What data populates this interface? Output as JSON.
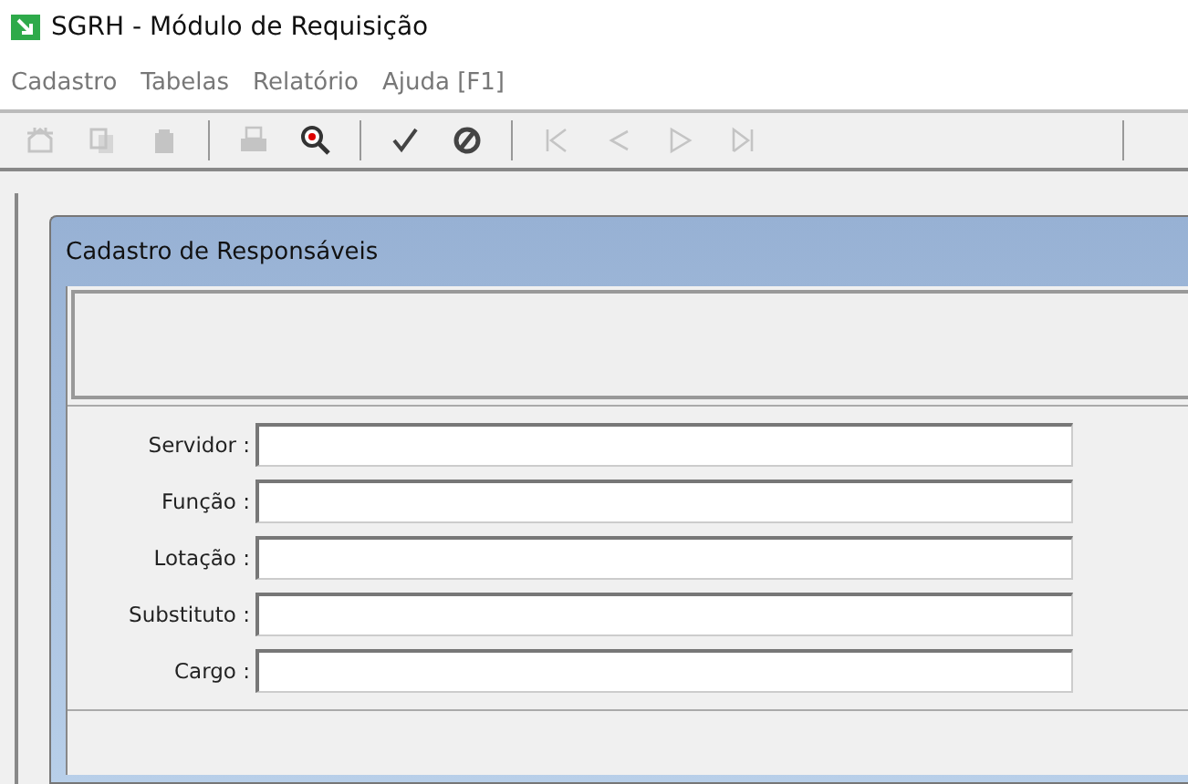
{
  "window": {
    "title": "SGRH - Módulo de Requisição"
  },
  "menu": [
    "Cadastro",
    "Tabelas",
    "Relatório",
    "Ajuda [F1]"
  ],
  "toolbar": [
    {
      "kind": "new",
      "disabled": true
    },
    {
      "kind": "copy",
      "disabled": true
    },
    {
      "kind": "delete",
      "disabled": true
    },
    {
      "kind": "separator"
    },
    {
      "kind": "print",
      "disabled": true
    },
    {
      "kind": "zoom",
      "disabled": false
    },
    {
      "kind": "separator"
    },
    {
      "kind": "confirm",
      "disabled": false
    },
    {
      "kind": "cancel",
      "disabled": false
    },
    {
      "kind": "separator"
    },
    {
      "kind": "first",
      "disabled": true
    },
    {
      "kind": "prev",
      "disabled": true
    },
    {
      "kind": "next",
      "disabled": true
    },
    {
      "kind": "last",
      "disabled": true
    },
    {
      "kind": "spacer"
    },
    {
      "kind": "separator"
    }
  ],
  "child_window": {
    "title": "Cadastro de Responsáveis"
  },
  "fields": [
    {
      "label": "Servidor :"
    },
    {
      "label": "Função :"
    },
    {
      "label": "Lotação :"
    },
    {
      "label": "Substituto :"
    },
    {
      "label": "Cargo :"
    }
  ]
}
